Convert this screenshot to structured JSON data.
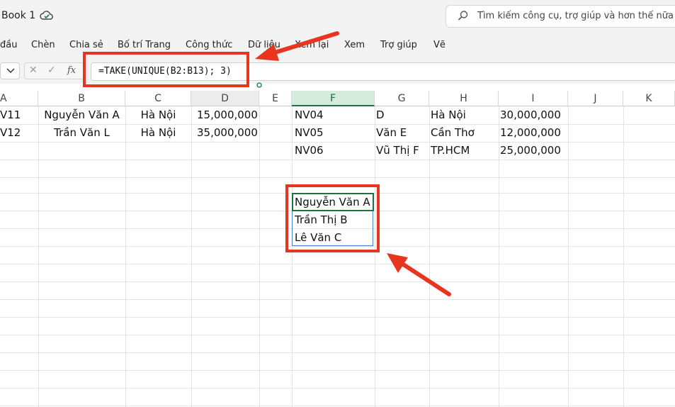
{
  "titlebar": {
    "doc_title": "Book 1",
    "search_placeholder": "Tìm kiếm công cụ, trợ giúp và hơn thế nữa (C"
  },
  "ribbon": {
    "tabs": [
      "đầu",
      "Chèn",
      "Chia sẻ",
      "Bố trí Trang",
      "Công thức",
      "Dữ liệu",
      "Xem lại",
      "Xem",
      "Trợ giúp",
      "Vẽ"
    ]
  },
  "formula_bar": {
    "cancel": "✕",
    "enter": "✓",
    "fx": "fx",
    "formula": "=TAKE(UNIQUE(B2:B13); 3)"
  },
  "columns": [
    "A",
    "B",
    "C",
    "D",
    "E",
    "F",
    "G",
    "H",
    "I",
    "J",
    "K"
  ],
  "rows": {
    "r1": {
      "a": "V11",
      "b": "Nguyễn Văn A",
      "c": "Hà Nội",
      "d": "15,000,000",
      "f": "NV04",
      "g": "D",
      "h": "Hà Nội",
      "i": "30,000,000"
    },
    "r2": {
      "a": "V12",
      "b": "Trần Văn L",
      "c": "Hà Nội",
      "d": "35,000,000",
      "f": "NV05",
      "g": "Văn E",
      "h": "Cần Thơ",
      "i": "12,000,000"
    },
    "r3": {
      "f": "NV06",
      "g": "Vũ Thị F",
      "h": "TP.HCM",
      "i": "25,000,000"
    }
  },
  "result": [
    "Nguyễn Văn A",
    "Trần Thị B",
    "Lê Văn C"
  ],
  "colors": {
    "highlight": "#e8351f",
    "selection": "#1e7145",
    "header_selected_bg": "#d6ebdc"
  }
}
